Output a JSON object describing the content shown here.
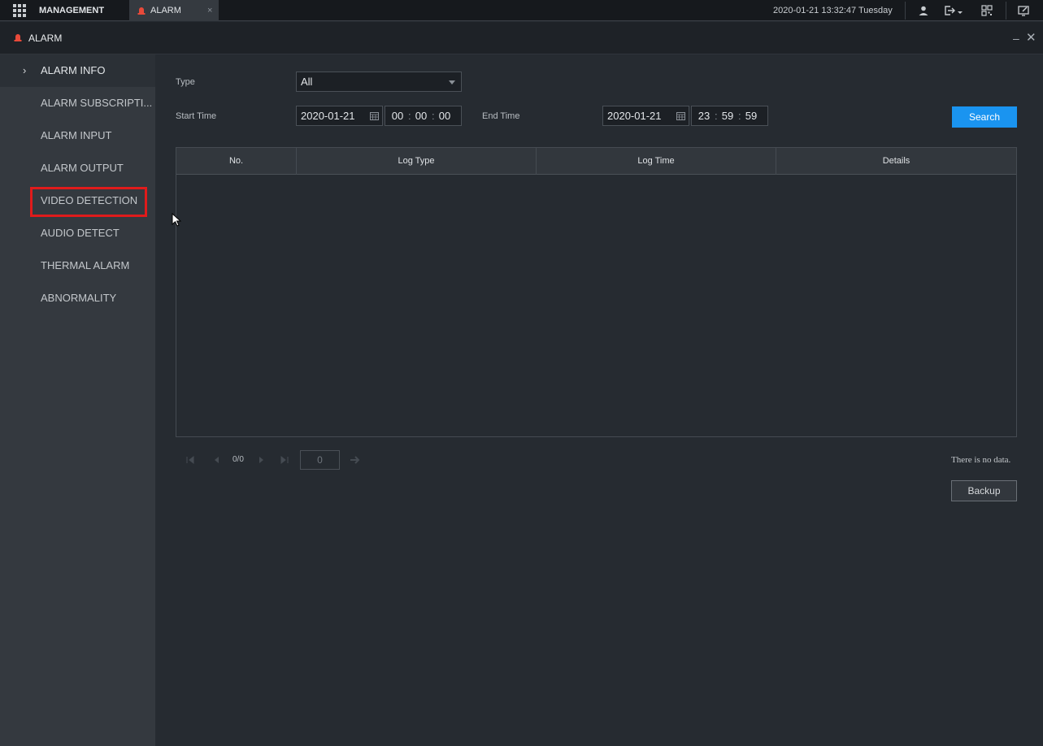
{
  "topbar": {
    "management_label": "MANAGEMENT",
    "tab_label": "ALARM",
    "tab_close": "×",
    "datetime": "2020-01-21 13:32:47 Tuesday"
  },
  "title": {
    "text": "ALARM",
    "minimize": "–",
    "close": "✕"
  },
  "sidebar": {
    "items": [
      {
        "label": "ALARM INFO",
        "active": true
      },
      {
        "label": "ALARM SUBSCRIPTI..."
      },
      {
        "label": "ALARM INPUT"
      },
      {
        "label": "ALARM OUTPUT"
      },
      {
        "label": "VIDEO DETECTION",
        "highlighted": true
      },
      {
        "label": "AUDIO DETECT"
      },
      {
        "label": "THERMAL ALARM"
      },
      {
        "label": "ABNORMALITY"
      }
    ],
    "chevron": "›"
  },
  "filters": {
    "type_label": "Type",
    "type_value": "All",
    "start_label": "Start Time",
    "start_date": "2020-01-21",
    "start_time": {
      "h": "00",
      "m": "00",
      "s": "00"
    },
    "end_label": "End Time",
    "end_date": "2020-01-21",
    "end_time": {
      "h": "23",
      "m": "59",
      "s": "59"
    },
    "search_label": "Search",
    "colon": ":"
  },
  "table": {
    "columns": [
      "No.",
      "Log Type",
      "Log Time",
      "Details"
    ],
    "rows": []
  },
  "pager": {
    "count": "0/0",
    "page_input": "0"
  },
  "status": {
    "no_data": "There is no data.",
    "backup_label": "Backup"
  },
  "colors": {
    "accent": "#1a94f0",
    "highlight": "#e01b1b",
    "siren": "#e84a3a"
  }
}
